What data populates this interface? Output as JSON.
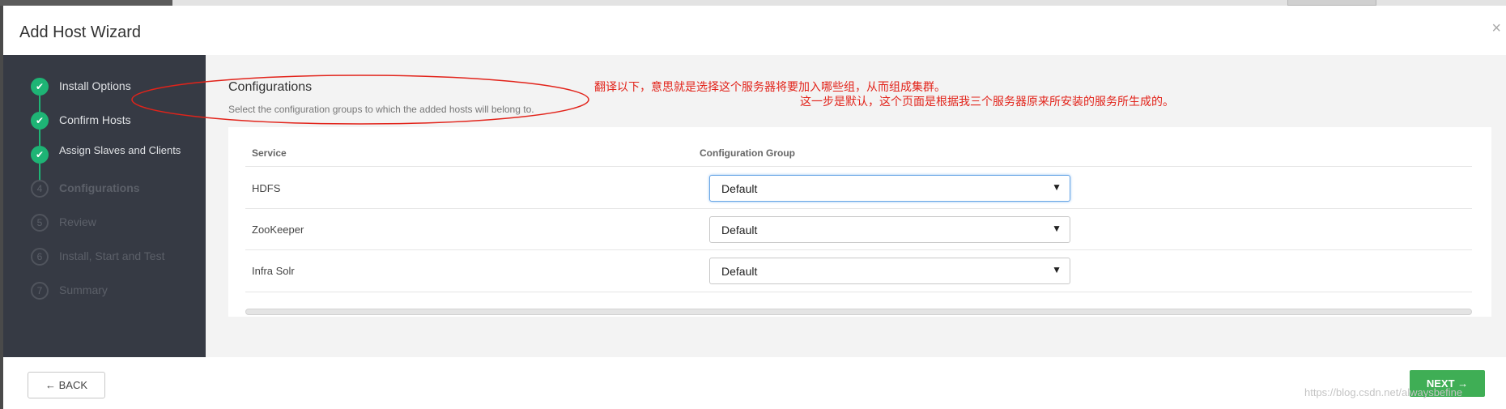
{
  "wizard": {
    "title": "Add Host Wizard",
    "close_glyph": "×"
  },
  "steps": [
    {
      "number": "1",
      "label": "Install Options",
      "state": "done"
    },
    {
      "number": "2",
      "label": "Confirm Hosts",
      "state": "done"
    },
    {
      "number": "3",
      "label": "Assign Slaves and Clients",
      "state": "done"
    },
    {
      "number": "4",
      "label": "Configurations",
      "state": "current"
    },
    {
      "number": "5",
      "label": "Review",
      "state": "todo"
    },
    {
      "number": "6",
      "label": "Install, Start and Test",
      "state": "todo"
    },
    {
      "number": "7",
      "label": "Summary",
      "state": "todo"
    }
  ],
  "configurations": {
    "title": "Configurations",
    "subtitle": "Select the configuration groups to which the added hosts will belong to.",
    "columns": {
      "service": "Service",
      "group": "Configuration Group"
    },
    "rows": [
      {
        "service": "HDFS",
        "group": "Default"
      },
      {
        "service": "ZooKeeper",
        "group": "Default"
      },
      {
        "service": "Infra Solr",
        "group": "Default"
      }
    ]
  },
  "footer": {
    "back_label": "← BACK",
    "next_label": "NEXT →"
  },
  "annotations": {
    "line1": "翻译以下，意思就是选择这个服务器将要加入哪些组，从而组成集群。",
    "line2": "这一步是默认，这个页面是根据我三个服务器原来所安装的服务所生成的。"
  },
  "watermark": "https://blog.csdn.net/alwaysbefine",
  "colors": {
    "sidebar": "#363a44",
    "step_done": "#1eb475",
    "next_button": "#3fae55",
    "annotation": "#e2231a"
  }
}
